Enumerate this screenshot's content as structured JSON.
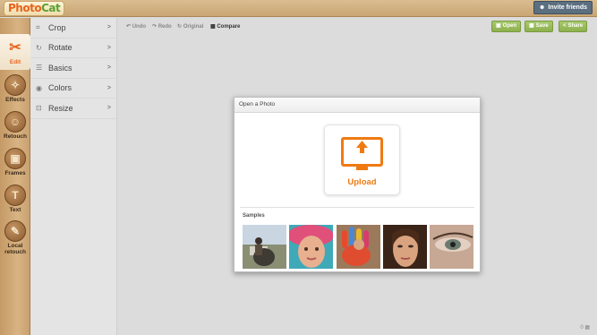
{
  "app": {
    "logo_part1": "Photo",
    "logo_part2": "Cat"
  },
  "header": {
    "invite_label": "Invite friends",
    "invite_icon": "people-icon"
  },
  "rail": {
    "tools": [
      {
        "label": "Edit",
        "icon": "scissors-icon",
        "glyph": "✂",
        "active": true
      },
      {
        "label": "Effects",
        "icon": "wand-icon",
        "glyph": "✧"
      },
      {
        "label": "Retouch",
        "icon": "face-icon",
        "glyph": "☺"
      },
      {
        "label": "Frames",
        "icon": "frame-icon",
        "glyph": "▣"
      },
      {
        "label": "Text",
        "icon": "text-icon",
        "glyph": "T"
      },
      {
        "label": "Local retouch",
        "icon": "brush-icon",
        "glyph": "✎"
      }
    ]
  },
  "submenu": {
    "items": [
      {
        "label": "Crop",
        "icon": "crop-icon",
        "glyph": "⌗"
      },
      {
        "label": "Rotate",
        "icon": "rotate-icon",
        "glyph": "↻"
      },
      {
        "label": "Basics",
        "icon": "sliders-icon",
        "glyph": "☰"
      },
      {
        "label": "Colors",
        "icon": "palette-icon",
        "glyph": "◉"
      },
      {
        "label": "Resize",
        "icon": "resize-icon",
        "glyph": "⊡"
      }
    ],
    "chevron": ">"
  },
  "toolbar": {
    "undo": "Undo",
    "redo": "Redo",
    "original": "Original",
    "compare": "Compare",
    "open": "Open",
    "save": "Save",
    "share": "Share"
  },
  "dialog": {
    "title": "Open a Photo",
    "upload_label": "Upload",
    "samples_label": "Samples"
  },
  "status": {
    "counter": "0"
  },
  "colors": {
    "accent": "#f07a12",
    "green": "#8db04f",
    "wood": "#c9a171"
  }
}
